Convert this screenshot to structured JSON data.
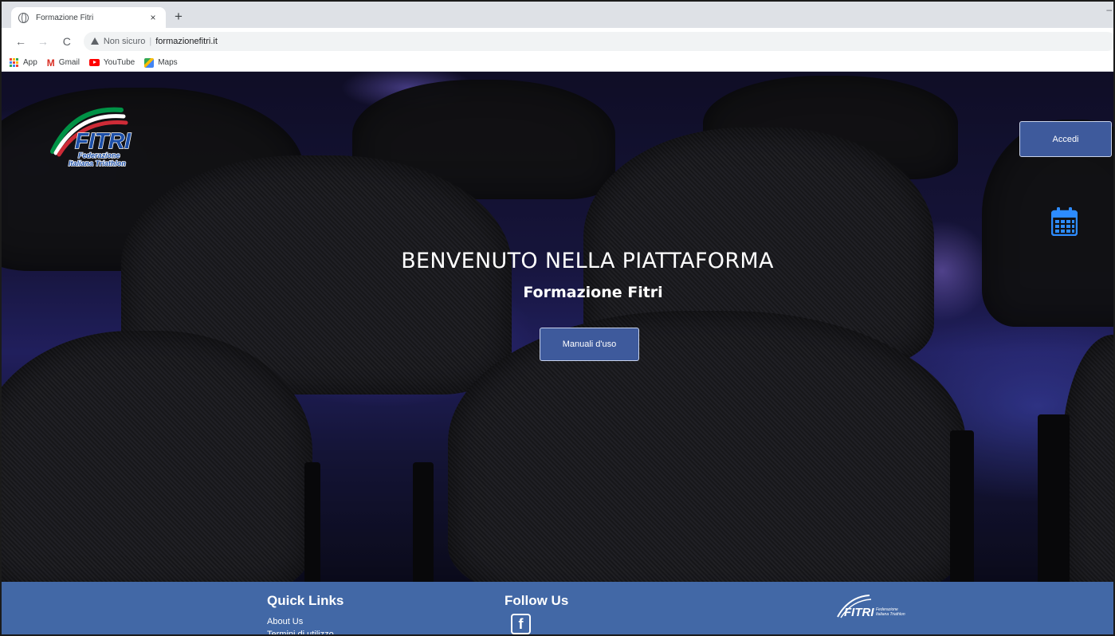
{
  "browser": {
    "tab_title": "Formazione Fitri",
    "tab_close": "×",
    "new_tab": "+",
    "minimize": "–",
    "back": "←",
    "forward": "→",
    "reload": "C",
    "security_label": "Non sicuro",
    "url": "formazionefitri.it",
    "bookmarks": [
      {
        "label": "App",
        "icon": "apps-icon"
      },
      {
        "label": "Gmail",
        "icon": "gmail-icon"
      },
      {
        "label": "YouTube",
        "icon": "youtube-icon"
      },
      {
        "label": "Maps",
        "icon": "maps-icon"
      }
    ]
  },
  "header": {
    "logo_text": "FITRI",
    "logo_sub1": "Federazione",
    "logo_sub2": "Italiana Triathlon",
    "login_button": "Accedi",
    "calendar_icon": "calendar-icon"
  },
  "hero": {
    "title": "BENVENUTO NELLA PIATTAFORMA",
    "subtitle": "Formazione Fitri",
    "manuals_button": "Manuali d'uso"
  },
  "footer": {
    "quick_links_title": "Quick Links",
    "quick_links": [
      "About Us",
      "Termini di utilizzo"
    ],
    "follow_title": "Follow Us",
    "facebook_glyph": "f",
    "logo_text": "FITRI",
    "logo_sub1": "Federazione",
    "logo_sub2": "Italiana Triathlon"
  },
  "colors": {
    "accent": "#3e5a9c",
    "footer": "#4268a6",
    "calendar": "#2d8cff"
  }
}
